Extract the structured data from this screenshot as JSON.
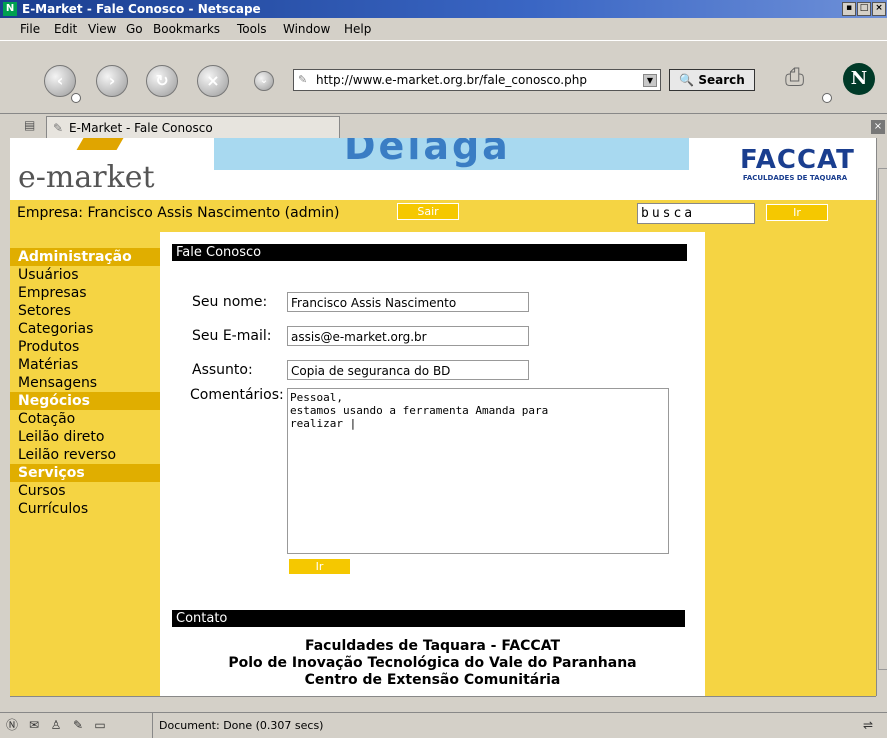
{
  "window": {
    "title": "E-Market - Fale Conosco - Netscape"
  },
  "menu": [
    "File",
    "Edit",
    "View",
    "Go",
    "Bookmarks",
    "Tools",
    "Window",
    "Help"
  ],
  "nav": {
    "url": "http://www.e-market.org.br/fale_conosco.php",
    "search_label": "Search"
  },
  "tab": {
    "label": "E-Market - Fale Conosco"
  },
  "header": {
    "logo_text": "e-market",
    "banner_text": "Delaga",
    "partner_logo": "FACCAT",
    "partner_sub": "FACULDADES DE TAQUARA",
    "empresa": "Empresa: Francisco Assis Nascimento (admin)",
    "sair_label": "Sair",
    "search_value": "busca",
    "ir_label": "Ir"
  },
  "sidebar": {
    "sections": [
      {
        "title": "Administração",
        "items": [
          "Usuários",
          "Empresas",
          "Setores",
          "Categorias",
          "Produtos",
          "Matérias",
          "Mensagens"
        ]
      },
      {
        "title": "Negócios",
        "items": [
          "Cotação",
          "Leilão direto",
          "Leilão reverso"
        ]
      },
      {
        "title": "Serviços",
        "items": [
          "Cursos",
          "Currículos"
        ]
      }
    ]
  },
  "form": {
    "section_title": "Fale Conosco",
    "name_label": "Seu nome:",
    "name_value": "Francisco Assis Nascimento",
    "email_label": "Seu E-mail:",
    "email_value": "assis@e-market.org.br",
    "subject_label": "Assunto:",
    "subject_value": "Copia de seguranca do BD",
    "comments_label": "Comentários:",
    "comments_value": "Pessoal,\nestamos usando a ferramenta Amanda para\nrealizar |",
    "submit_label": "Ir"
  },
  "contact": {
    "section_title": "Contato",
    "line1": "Faculdades de Taquara - FACCAT",
    "line2": "Polo de Inovação Tecnológica do Vale do Paranhana",
    "line3": "Centro de Extensão Comunitária"
  },
  "status": {
    "text": "Document: Done (0.307 secs)"
  },
  "colors": {
    "page_yellow": "#f5d443",
    "section_gold": "#e0ae00",
    "title_blue": "#1a3e8f"
  }
}
